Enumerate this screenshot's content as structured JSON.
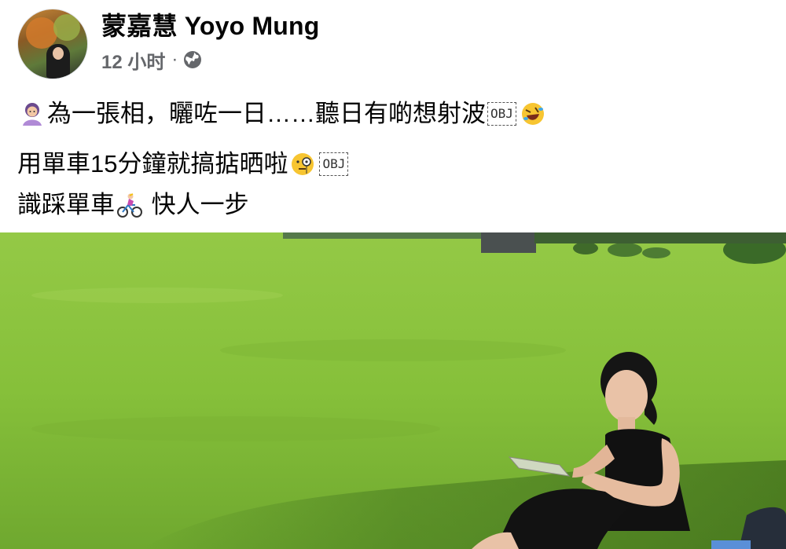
{
  "post": {
    "author_name": "蒙嘉慧 Yoyo Mung",
    "time_text": "12 小时",
    "separator": "·",
    "privacy_icon": "globe-icon",
    "lines": [
      {
        "segments": [
          {
            "type": "emoji",
            "name": "woman-shrugging-emoji"
          },
          {
            "type": "text",
            "value": "為一張相，曬咗一日……聽日有啲想射波"
          },
          {
            "type": "obj",
            "value": "OBJ"
          },
          {
            "type": "emoji",
            "name": "rolling-laughing-emoji"
          }
        ]
      },
      {
        "segments": [
          {
            "type": "text",
            "value": "用單車15分鐘就搞掂晒啦"
          },
          {
            "type": "emoji",
            "name": "face-with-monocle-emoji"
          },
          {
            "type": "obj",
            "value": "OBJ"
          }
        ]
      },
      {
        "segments": [
          {
            "type": "text",
            "value": "識踩單車"
          },
          {
            "type": "emoji",
            "name": "person-biking-emoji"
          },
          {
            "type": "text",
            "value": " 快人一步"
          }
        ]
      }
    ],
    "photo": {
      "subject": "woman-sitting-on-grass",
      "colors": {
        "grass": "#8cc43b",
        "shirt": "#111111",
        "sky_trees": "#3f6a2a"
      }
    }
  }
}
